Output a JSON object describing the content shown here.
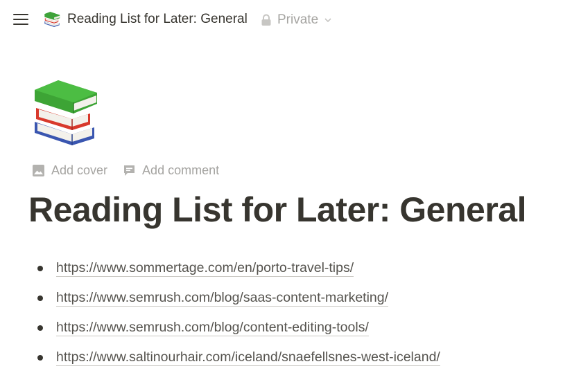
{
  "topbar": {
    "menu_icon": "hamburger-menu-icon",
    "page_icon": "books-icon",
    "breadcrumb_title": "Reading List for Later: General",
    "privacy_label": "Private",
    "privacy_icon": "lock-icon",
    "privacy_chevron": "chevron-down-icon"
  },
  "page": {
    "icon": "books-icon",
    "actions": [
      {
        "label": "Add cover",
        "icon": "image-icon"
      },
      {
        "label": "Add comment",
        "icon": "comment-icon"
      }
    ],
    "title": "Reading List for Later: General",
    "links": [
      "https://www.sommertage.com/en/porto-travel-tips/",
      "https://www.semrush.com/blog/saas-content-marketing/",
      "https://www.semrush.com/blog/content-editing-tools/",
      "https://www.saltinourhair.com/iceland/snaefellsnes-west-iceland/"
    ]
  },
  "colors": {
    "text": "#37352f",
    "muted": "#a5a4a1",
    "link": "#55534e",
    "background": "#ffffff"
  }
}
